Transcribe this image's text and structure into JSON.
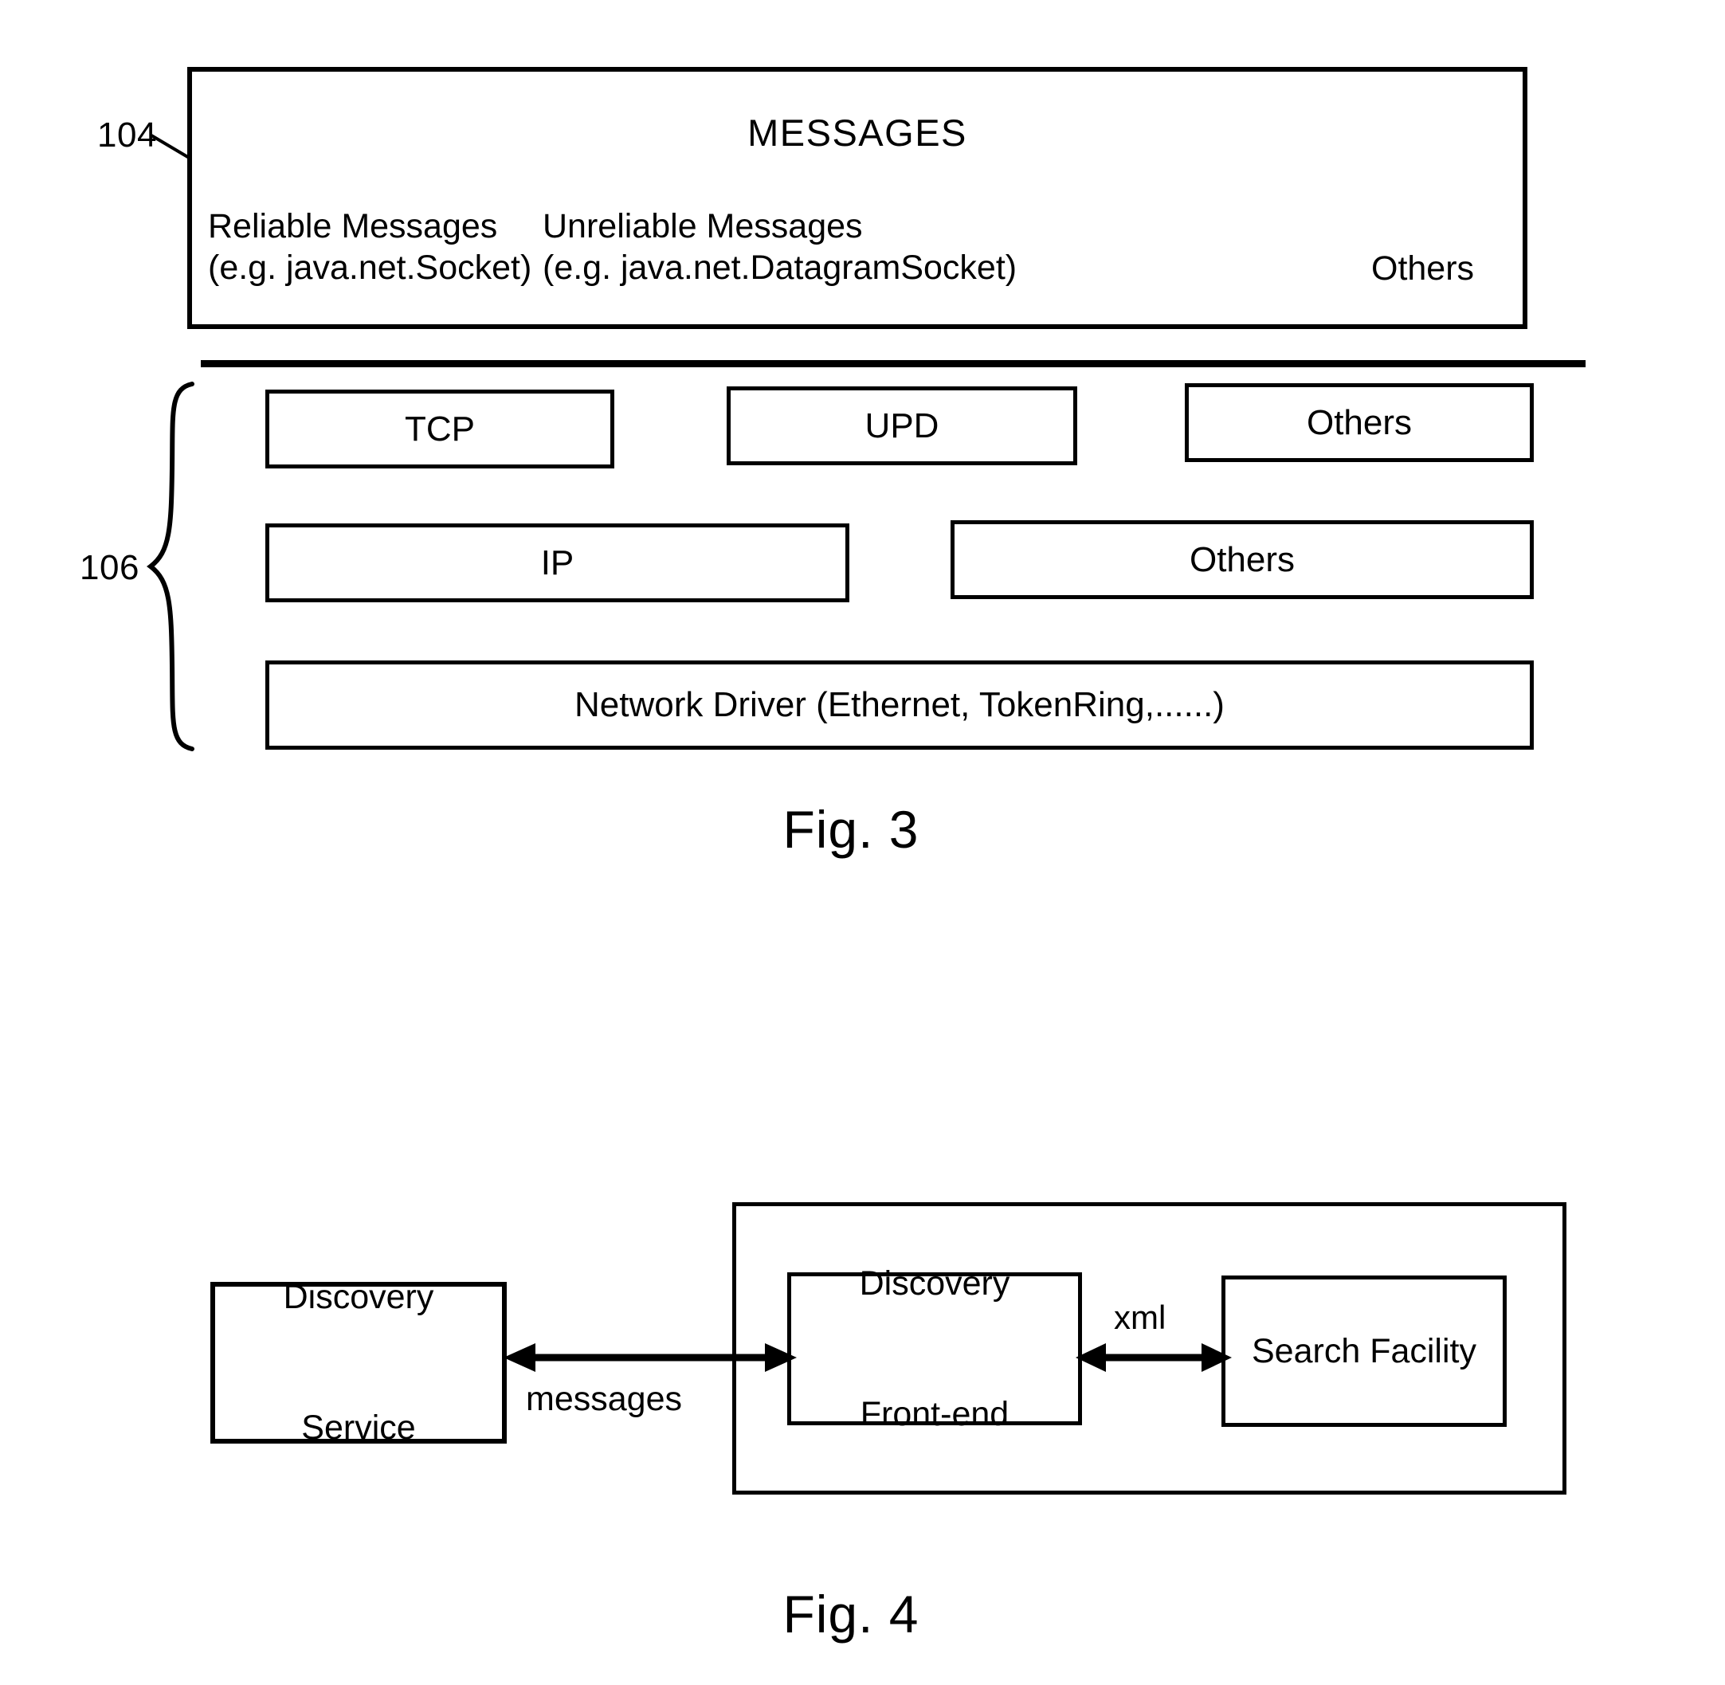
{
  "figures": [
    {
      "caption": "Fig. 3",
      "reference_numbers": {
        "messages_layer": "104",
        "protocol_layer": "106"
      },
      "messages_box": {
        "title": "MESSAGES",
        "columns": [
          {
            "name": "Reliable Messages",
            "example": "(e.g. java.net.Socket)"
          },
          {
            "name": "Unreliable Messages",
            "example": "(e.g. java.net.DatagramSocket)"
          },
          {
            "name": "Others",
            "example": ""
          }
        ]
      },
      "protocol_stack": {
        "row1": [
          "TCP",
          "UPD",
          "Others"
        ],
        "row2": [
          "IP",
          "Others"
        ],
        "row3": [
          "Network Driver (Ethernet, TokenRing,......)"
        ]
      }
    },
    {
      "caption": "Fig. 4",
      "blocks": {
        "discovery_service": "Discovery\nService",
        "discovery_front_end": "Discovery\nFront-end",
        "search_facility": "Search Facility"
      },
      "connections": [
        {
          "label": "messages",
          "from": "discovery_service",
          "to": "discovery_front_end",
          "kind": "bidirectional"
        },
        {
          "label": "xml",
          "from": "discovery_front_end",
          "to": "search_facility",
          "kind": "bidirectional"
        }
      ]
    }
  ],
  "fig3": {
    "ref_104": "104",
    "ref_106": "106",
    "caption": "Fig. 3",
    "messages_title": "MESSAGES",
    "col_reliable_line1": "Reliable Messages",
    "col_reliable_line2": "(e.g. java.net.Socket)",
    "col_unreliable_line1": "Unreliable Messages",
    "col_unreliable_line2": "(e.g. java.net.DatagramSocket)",
    "col_others": "Others",
    "tcp": "TCP",
    "udp": "UPD",
    "others_transport": "Others",
    "ip": "IP",
    "others_network": "Others",
    "network_driver": "Network Driver (Ethernet, TokenRing,......)"
  },
  "fig4": {
    "caption": "Fig. 4",
    "discovery_service_line1": "Discovery",
    "discovery_service_line2": "Service",
    "front_end_line1": "Discovery",
    "front_end_line2": "Front-end",
    "search_facility": "Search Facility",
    "messages_label": "messages",
    "xml_label": "xml"
  },
  "colors": {
    "ink": "#000000",
    "paper": "#ffffff"
  }
}
